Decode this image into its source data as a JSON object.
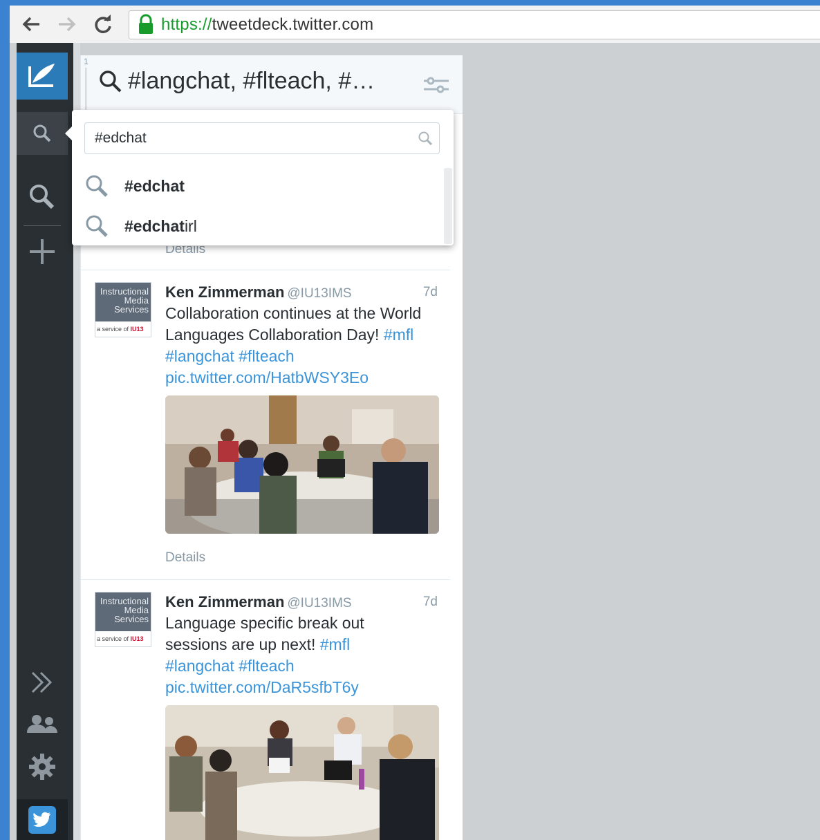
{
  "browser": {
    "url_scheme": "https://",
    "url_host": "tweetdeck.twitter.com",
    "back_icon": "arrow-left-icon",
    "forward_icon": "arrow-right-icon",
    "reload_icon": "reload-icon"
  },
  "sidebar": {
    "compose_icon": "compose-icon",
    "items": [
      "search-icon",
      "search-icon",
      "add-column-icon",
      "expand-icon",
      "accounts-icon",
      "settings-icon",
      "twitter-bird-icon"
    ]
  },
  "column": {
    "number": "1",
    "title": "#langchat, #flteach, #…",
    "details_partial": "Details"
  },
  "search_popup": {
    "query": "#edchat",
    "suggestions": [
      {
        "bold": "#edchat",
        "rest": ""
      },
      {
        "bold": "#edchat",
        "rest": "irl"
      }
    ]
  },
  "tweets": [
    {
      "name": "Ken Zimmerman",
      "handle": "@IU13IMS",
      "time": "7d",
      "text_parts": [
        "Collaboration continues at the World Languages Collaboration Day! ",
        "#mfl",
        " ",
        "#langchat",
        " ",
        "#flteach",
        " ",
        "pic.twitter.com/HatbWSY3Eo"
      ],
      "details": "Details",
      "avatar_top": "Instructional Media Services",
      "avatar_bottom": "a service of",
      "avatar_brand": "IU13"
    },
    {
      "name": "Ken Zimmerman",
      "handle": "@IU13IMS",
      "time": "7d",
      "text_parts": [
        "Language specific break out sessions are up next! ",
        "#mfl",
        " ",
        "#langchat",
        " ",
        "#flteach",
        " ",
        "pic.twitter.com/DaR5sfbT6y"
      ],
      "details": "",
      "avatar_top": "Instructional Media Services",
      "avatar_bottom": "a service of",
      "avatar_brand": "IU13"
    }
  ],
  "colors": {
    "accent": "#2b7bb9",
    "hashtag": "#3b94d9",
    "sidebar": "#292f33"
  }
}
